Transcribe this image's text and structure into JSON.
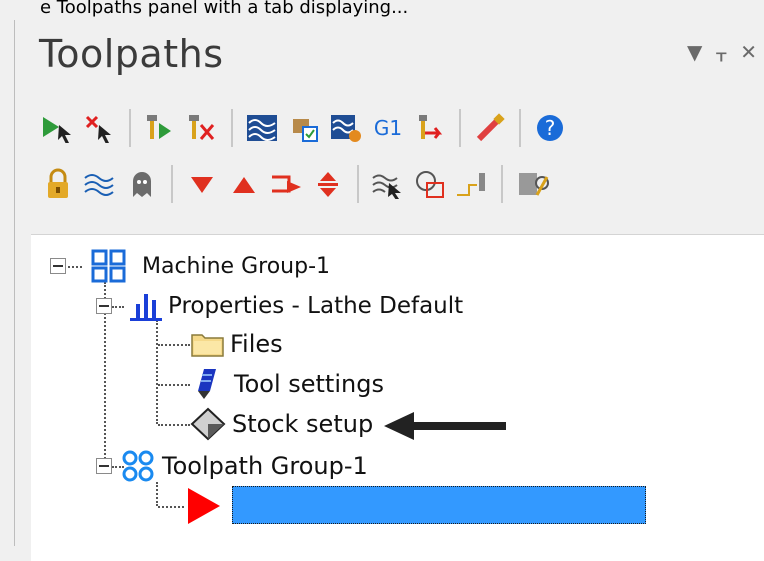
{
  "caption_fragment": "e Toolpaths panel with a tab displaying...",
  "panel": {
    "title": "Toolpaths",
    "controls": [
      "▼",
      "ᚁ",
      "✕"
    ]
  },
  "toolbar1": {
    "buttons": [
      {
        "icon": "select-all-operations-icon"
      },
      {
        "icon": "deselect-all-operations-icon"
      },
      {
        "icon": "regenerate-selected-icon"
      },
      {
        "icon": "regenerate-dirty-icon"
      },
      {
        "icon": "backplot-icon"
      },
      {
        "icon": "verify-icon"
      },
      {
        "icon": "simulate-icon"
      },
      {
        "icon": "post-g1-icon",
        "label": "G1"
      },
      {
        "icon": "highfeed-icon"
      },
      {
        "icon": "toolpath-editor-icon"
      },
      {
        "icon": "help-icon"
      }
    ]
  },
  "toolbar2": {
    "buttons": [
      {
        "icon": "lock-icon"
      },
      {
        "icon": "toggle-display-icon"
      },
      {
        "icon": "ghost-icon"
      },
      {
        "icon": "move-down-icon"
      },
      {
        "icon": "move-up-icon"
      },
      {
        "icon": "insert-arrow-icon"
      },
      {
        "icon": "scroll-expand-icon"
      },
      {
        "icon": "filter-icon"
      },
      {
        "icon": "display-toggle-icon"
      },
      {
        "icon": "tool-icon"
      },
      {
        "icon": "axis-icon"
      }
    ]
  },
  "tree": {
    "machine_group": "Machine Group-1",
    "properties": "Properties - Lathe Default",
    "files": "Files",
    "tool_settings": "Tool settings",
    "stock_setup": "Stock setup",
    "toolpath_group": "Toolpath Group-1"
  },
  "colors": {
    "selection": "#3399ff",
    "insert_arrow": "#ff0000",
    "accent_blue": "#1a6bd8"
  }
}
